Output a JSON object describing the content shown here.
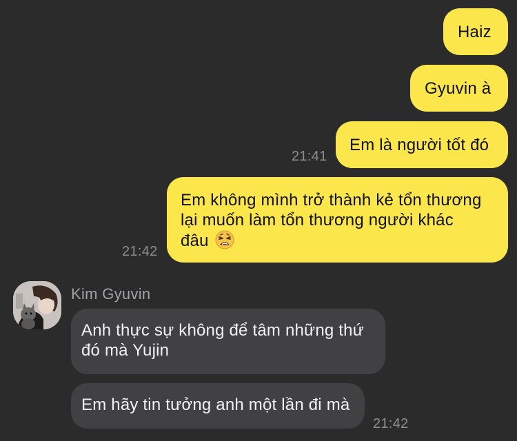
{
  "messages": {
    "out1": "Haiz",
    "out2": "Gyuvin à",
    "out3": "Em là người tốt đó",
    "out3_time": "21:41",
    "out4_line1": "Em không mình trở thành kẻ tổn thương",
    "out4_line2": "lại muốn làm tổn thương người khác",
    "out4_line3": "đâu",
    "out4_emoji": "weary-face-emoji",
    "out4_time": "21:42",
    "sender_name": "Kim Gyuvin",
    "in1_line1": "Anh thực sự không để tâm những thứ",
    "in1_line2": "đó mà Yujin",
    "in2": "Em hãy tin tưởng anh một lần đi mà",
    "in2_time": "21:42"
  },
  "colors": {
    "background": "#2b2b2c",
    "outgoing_bubble": "#fbe64c",
    "incoming_bubble": "#414143",
    "timestamp": "#8e8e92"
  }
}
